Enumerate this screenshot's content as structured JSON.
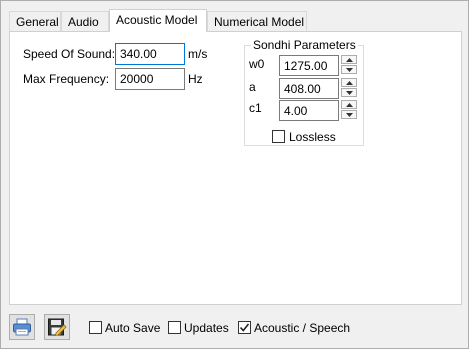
{
  "tabs": [
    {
      "label": "General"
    },
    {
      "label": "Audio"
    },
    {
      "label": "Acoustic Model"
    },
    {
      "label": "Numerical Model"
    }
  ],
  "acoustic": {
    "speed_label": "Speed Of Sound:",
    "speed_value": "340.00",
    "speed_unit": "m/s",
    "freq_label": "Max Frequency:",
    "freq_value": "20000",
    "freq_unit": "Hz"
  },
  "sondhi": {
    "title": "Sondhi Parameters",
    "params": [
      {
        "label": "w0",
        "value": "1275.00"
      },
      {
        "label": "a",
        "value": "408.00"
      },
      {
        "label": "c1",
        "value": "4.00"
      }
    ],
    "lossless_label": "Lossless",
    "lossless_checked": false
  },
  "bottom": {
    "auto_save_label": "Auto Save",
    "auto_save_checked": false,
    "updates_label": "Updates",
    "updates_checked": false,
    "acoustic_speech_label": "Acoustic / Speech",
    "acoustic_speech_checked": true,
    "print_icon": "printer-icon",
    "save_icon": "save-edit-icon"
  }
}
